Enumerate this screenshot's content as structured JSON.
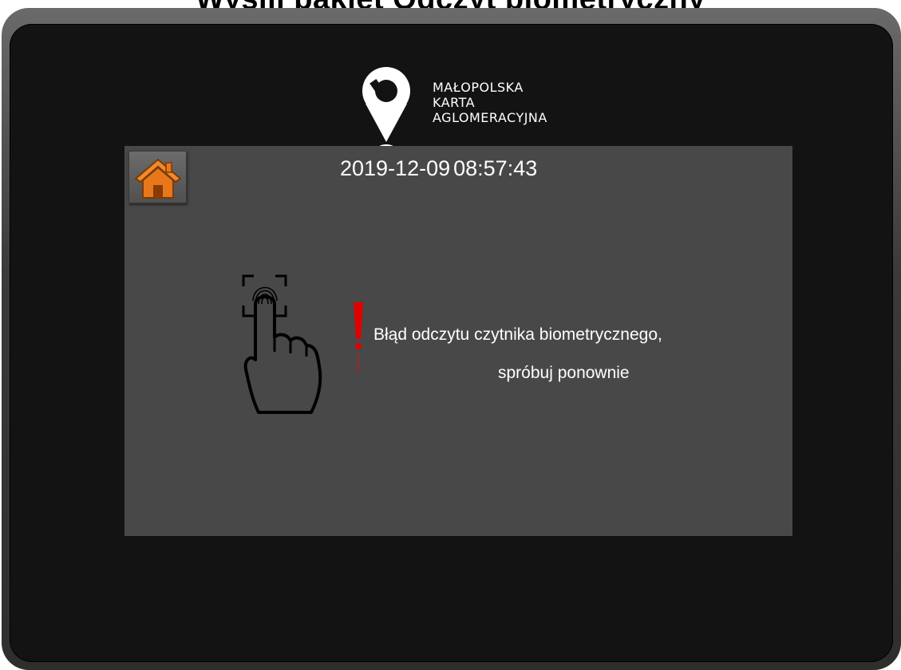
{
  "header": {
    "cropped_title": "Wyślij pakiet Odczyt biometryczny"
  },
  "logo": {
    "lines": [
      "MAŁOPOLSKA",
      "KARTA",
      "AGLOMERACYJNA"
    ]
  },
  "panel": {
    "home_icon": "home-icon",
    "date": "2019-12-09",
    "time": "08:57:43",
    "fingerprint_icon": "fingerprint-scan-icon",
    "warning_icon": "exclamation-icon",
    "message_line1": "Błąd odczytu czytnika biometrycznego,",
    "message_line2": "spróbuj ponownie"
  },
  "colors": {
    "panel_bg": "#484848",
    "bezel": "#131313",
    "home_accent": "#e8771c",
    "warning": "#e00000"
  }
}
